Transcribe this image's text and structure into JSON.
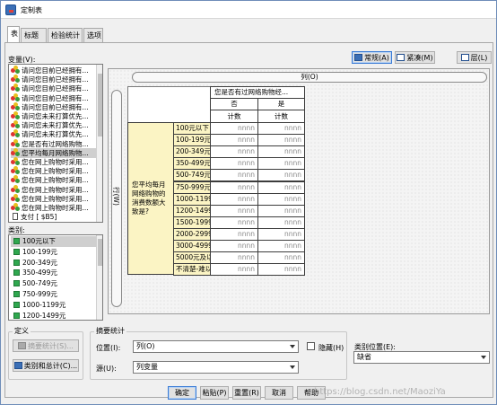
{
  "window": {
    "title": "定制表"
  },
  "tabs": [
    {
      "label": "表"
    },
    {
      "label": "标题"
    },
    {
      "label": "检验统计"
    },
    {
      "label": "选项"
    }
  ],
  "variables": {
    "label": "变量(V):",
    "items": [
      {
        "label": "请问您目前已经拥有..."
      },
      {
        "label": "请问您目前已经拥有..."
      },
      {
        "label": "请问您目前已经拥有..."
      },
      {
        "label": "请问您目前已经拥有..."
      },
      {
        "label": "请问您目前已经拥有..."
      },
      {
        "label": "请问您未来打算优先..."
      },
      {
        "label": "请问您未来打算优先..."
      },
      {
        "label": "请问您未来打算优先..."
      },
      {
        "label": "您是否有过网络购物..."
      },
      {
        "label": "您平均每月网络购物..."
      },
      {
        "label": "您在网上购物时采用..."
      },
      {
        "label": "您在网上购物时采用..."
      },
      {
        "label": "您在网上购物时采用..."
      },
      {
        "label": "您在网上购物时采用..."
      },
      {
        "label": "您在网上购物时采用..."
      },
      {
        "label": "您在网上购物时采用..."
      },
      {
        "label": "支付 [ $B5]"
      }
    ],
    "selected_index": 9
  },
  "categories": {
    "label": "类别:",
    "items": [
      {
        "label": "100元以下"
      },
      {
        "label": "100-199元"
      },
      {
        "label": "200-349元"
      },
      {
        "label": "350-499元"
      },
      {
        "label": "500-749元"
      },
      {
        "label": "750-999元"
      },
      {
        "label": "1000-1199元"
      },
      {
        "label": "1200-1499元"
      }
    ],
    "selected_index": 0
  },
  "view_buttons": {
    "normal": "常规(A)",
    "compact": "紧凑(M)",
    "layers": "层(L)"
  },
  "canvas": {
    "column_label": "列(O)",
    "row_label": "行(W)"
  },
  "table": {
    "col_var": "您是否有过网络购物经...",
    "col_cats": [
      "否",
      "是"
    ],
    "stat": "计数",
    "row_var": "您平均每月网络购物的消费数额大致是?",
    "row_cats": [
      "100元以下",
      "100-199元",
      "200-349元",
      "350-499元",
      "500-749元",
      "750-999元",
      "1000-1199...",
      "1200-1499...",
      "1500-1999...",
      "2000-2999...",
      "3000-4999...",
      "5000元及以...",
      "不清楚-难以..."
    ],
    "placeholder": "nnnn"
  },
  "define": {
    "title": "定义",
    "summary_stats_button": "摘要统计(S)...",
    "cats_totals_button": "类别和总计(C)..."
  },
  "summary": {
    "title": "摘要统计",
    "position_label": "位置(I):",
    "position_value": "列(O)",
    "source_label": "源(U):",
    "source_value": "列变量",
    "hide_label": "隐藏(H)"
  },
  "cat_position": {
    "label": "类别位置(E):",
    "value": "缺省"
  },
  "footer": {
    "ok": "确定",
    "paste": "粘贴(P)",
    "reset": "重置(R)",
    "cancel": "取消",
    "help": "帮助"
  },
  "watermark": "https://blog.csdn.net/MaoziYa"
}
